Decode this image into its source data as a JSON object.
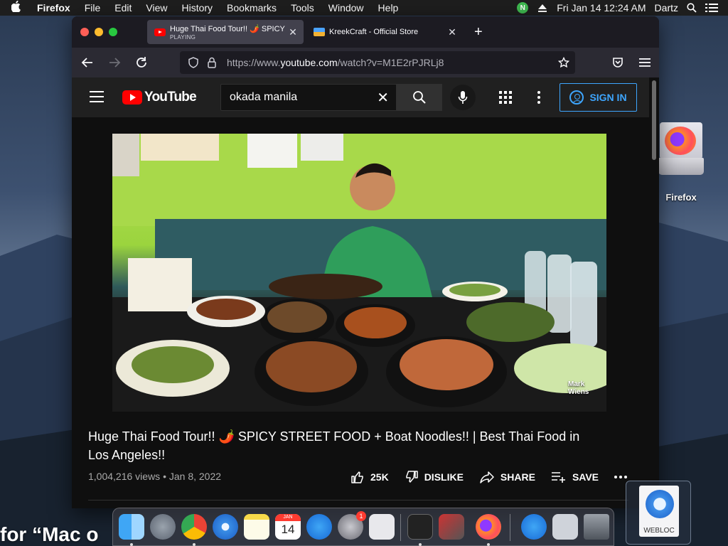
{
  "menubar": {
    "app": "Firefox",
    "items": [
      "File",
      "Edit",
      "View",
      "History",
      "Bookmarks",
      "Tools",
      "Window",
      "Help"
    ],
    "clock": "Fri Jan 14  12:24 AM",
    "user": "Dartz",
    "n_badge": "N"
  },
  "browser": {
    "tabs": [
      {
        "title": "Huge Thai Food Tour!! 🌶️ SPICY",
        "subtitle": "PLAYING"
      },
      {
        "title": "KreekCraft - Official Store",
        "subtitle": ""
      }
    ],
    "url_prefix": "https://www.",
    "url_domain": "youtube.com",
    "url_path": "/watch?v=M1E2rPJRLj8"
  },
  "youtube": {
    "logo_text": "YouTube",
    "search_value": "okada manila",
    "sign_in": "SIGN IN",
    "video_title": "Huge Thai Food Tour!! 🌶️ SPICY STREET FOOD + Boat Noodles!! | Best Thai Food in Los Angeles!!",
    "meta": "1,004,216 views • Jan 8, 2022",
    "likes": "25K",
    "dislike": "DISLIKE",
    "share": "SHARE",
    "save": "SAVE",
    "watermark": "Mark Wiens"
  },
  "desktop": {
    "firefox_icon_label": "Firefox",
    "webloc_label": "WEBLOC",
    "peek_text": "for “Mac o"
  },
  "dock": {
    "calendar_month": "JAN",
    "calendar_day": "14",
    "settings_badge": "1"
  },
  "colors": {
    "accent_blue": "#3ea6ff",
    "youtube_red": "#ff0000",
    "page_bg": "#0f0f0f"
  }
}
